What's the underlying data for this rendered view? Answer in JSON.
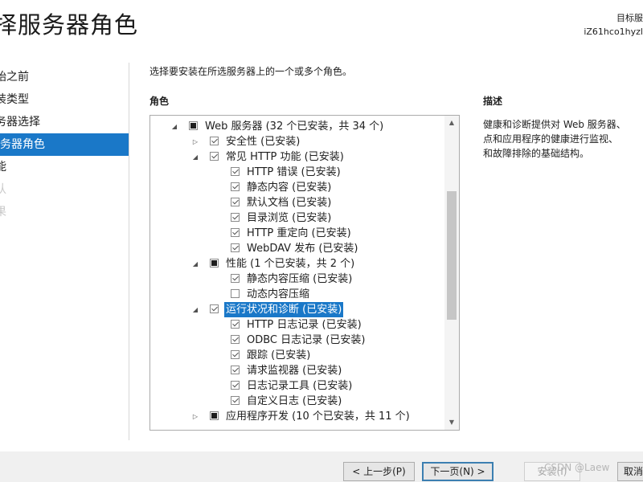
{
  "header": {
    "title": "择服务器角色",
    "target_label": "目标服",
    "target_server": "iZ61hco1hyzl"
  },
  "nav": {
    "items": [
      {
        "label": "始之前",
        "state": "normal"
      },
      {
        "label": "装类型",
        "state": "normal"
      },
      {
        "label": "务器选择",
        "state": "normal"
      },
      {
        "label": "务器角色",
        "state": "active"
      },
      {
        "label": "能",
        "state": "normal"
      },
      {
        "label": "认",
        "state": "disabled"
      },
      {
        "label": "果",
        "state": "disabled"
      }
    ]
  },
  "main": {
    "instruction": "选择要安装在所选服务器上的一个或多个角色。",
    "roles_heading": "角色",
    "roles": [
      {
        "label": "Web 服务器 (32 个已安装，共 34 个)",
        "level": 0,
        "expand": "expanded",
        "check": "partial"
      },
      {
        "label": "安全性 (已安装)",
        "level": 1,
        "expand": "collapsed",
        "check": "checked"
      },
      {
        "label": "常见 HTTP 功能 (已安装)",
        "level": 1,
        "expand": "expanded",
        "check": "checked"
      },
      {
        "label": "HTTP 错误 (已安装)",
        "level": 2,
        "expand": "none",
        "check": "checked"
      },
      {
        "label": "静态内容 (已安装)",
        "level": 2,
        "expand": "none",
        "check": "checked"
      },
      {
        "label": "默认文档 (已安装)",
        "level": 2,
        "expand": "none",
        "check": "checked"
      },
      {
        "label": "目录浏览 (已安装)",
        "level": 2,
        "expand": "none",
        "check": "checked"
      },
      {
        "label": "HTTP 重定向 (已安装)",
        "level": 2,
        "expand": "none",
        "check": "checked"
      },
      {
        "label": "WebDAV 发布 (已安装)",
        "level": 2,
        "expand": "none",
        "check": "checked"
      },
      {
        "label": "性能 (1 个已安装，共 2 个)",
        "level": 1,
        "expand": "expanded",
        "check": "partial"
      },
      {
        "label": "静态内容压缩 (已安装)",
        "level": 2,
        "expand": "none",
        "check": "checked"
      },
      {
        "label": "动态内容压缩",
        "level": 2,
        "expand": "none",
        "check": "unchecked"
      },
      {
        "label": "运行状况和诊断 (已安装)",
        "level": 1,
        "expand": "expanded",
        "check": "checked",
        "selected": true
      },
      {
        "label": "HTTP 日志记录 (已安装)",
        "level": 2,
        "expand": "none",
        "check": "checked"
      },
      {
        "label": "ODBC 日志记录 (已安装)",
        "level": 2,
        "expand": "none",
        "check": "checked"
      },
      {
        "label": "跟踪 (已安装)",
        "level": 2,
        "expand": "none",
        "check": "checked"
      },
      {
        "label": "请求监视器 (已安装)",
        "level": 2,
        "expand": "none",
        "check": "checked"
      },
      {
        "label": "日志记录工具 (已安装)",
        "level": 2,
        "expand": "none",
        "check": "checked"
      },
      {
        "label": "自定义日志 (已安装)",
        "level": 2,
        "expand": "none",
        "check": "checked"
      },
      {
        "label": "应用程序开发 (10 个已安装，共 11 个)",
        "level": 1,
        "expand": "collapsed",
        "check": "partial"
      }
    ],
    "description_heading": "描述",
    "description_lines": [
      "健康和诊断提供对 Web 服务器、",
      "点和应用程序的健康进行监视、",
      "和故障排除的基础结构。"
    ]
  },
  "footer": {
    "prev_label": "< 上一步(P)",
    "next_label": "下一页(N) >",
    "install_label": "安装(I)",
    "cancel_label": "取消",
    "watermark": "CSDN @Laew"
  },
  "icons": {
    "expanded": "triangle-down-icon",
    "collapsed": "triangle-right-icon",
    "scroll_up": "scroll-up-arrow-icon",
    "scroll_down": "scroll-down-arrow-icon"
  },
  "colors": {
    "accent": "#1a78c8",
    "primary_button_border": "#3c7fb1",
    "disabled_text": "#c8c8c8"
  }
}
